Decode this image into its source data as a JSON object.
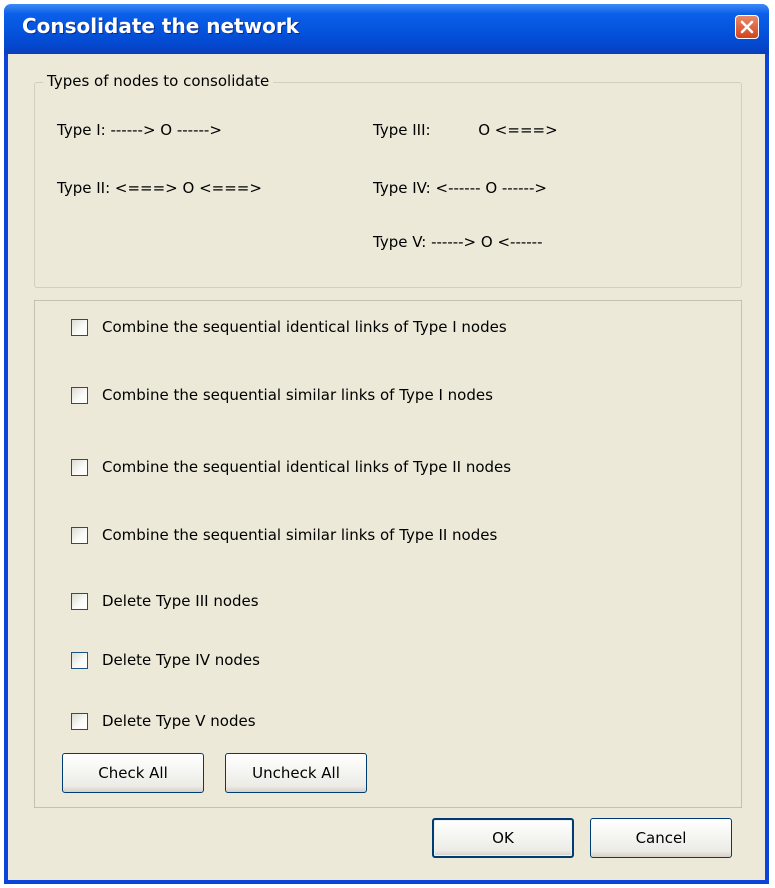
{
  "window": {
    "title": "Consolidate the network"
  },
  "node_types": {
    "legend": "Types of nodes to consolidate",
    "items": [
      "Type I:  ------> O ------>",
      "Type II: <===> O <===>",
      "Type III:          O <===>",
      "Type IV: <------ O ------>",
      "Type V:  ------> O <------"
    ]
  },
  "options": [
    {
      "label": "Combine the sequential identical links of Type I nodes",
      "checked": false
    },
    {
      "label": "Combine the sequential similar links of Type I nodes",
      "checked": false
    },
    {
      "label": "Combine the sequential identical links of Type II nodes",
      "checked": false
    },
    {
      "label": "Combine the sequential similar links of Type II nodes",
      "checked": false
    },
    {
      "label": "Delete Type III nodes",
      "checked": false
    },
    {
      "label": "Delete Type IV nodes",
      "checked": false
    },
    {
      "label": "Delete Type V nodes",
      "checked": false
    }
  ],
  "buttons": {
    "check_all": "Check All",
    "uncheck_all": "Uncheck All",
    "ok": "OK",
    "cancel": "Cancel"
  },
  "icons": {
    "close": "close-icon"
  },
  "colors": {
    "titlebar": "#0553dd",
    "dialog_background": "#ece9d8",
    "close_button": "#d2431c"
  }
}
